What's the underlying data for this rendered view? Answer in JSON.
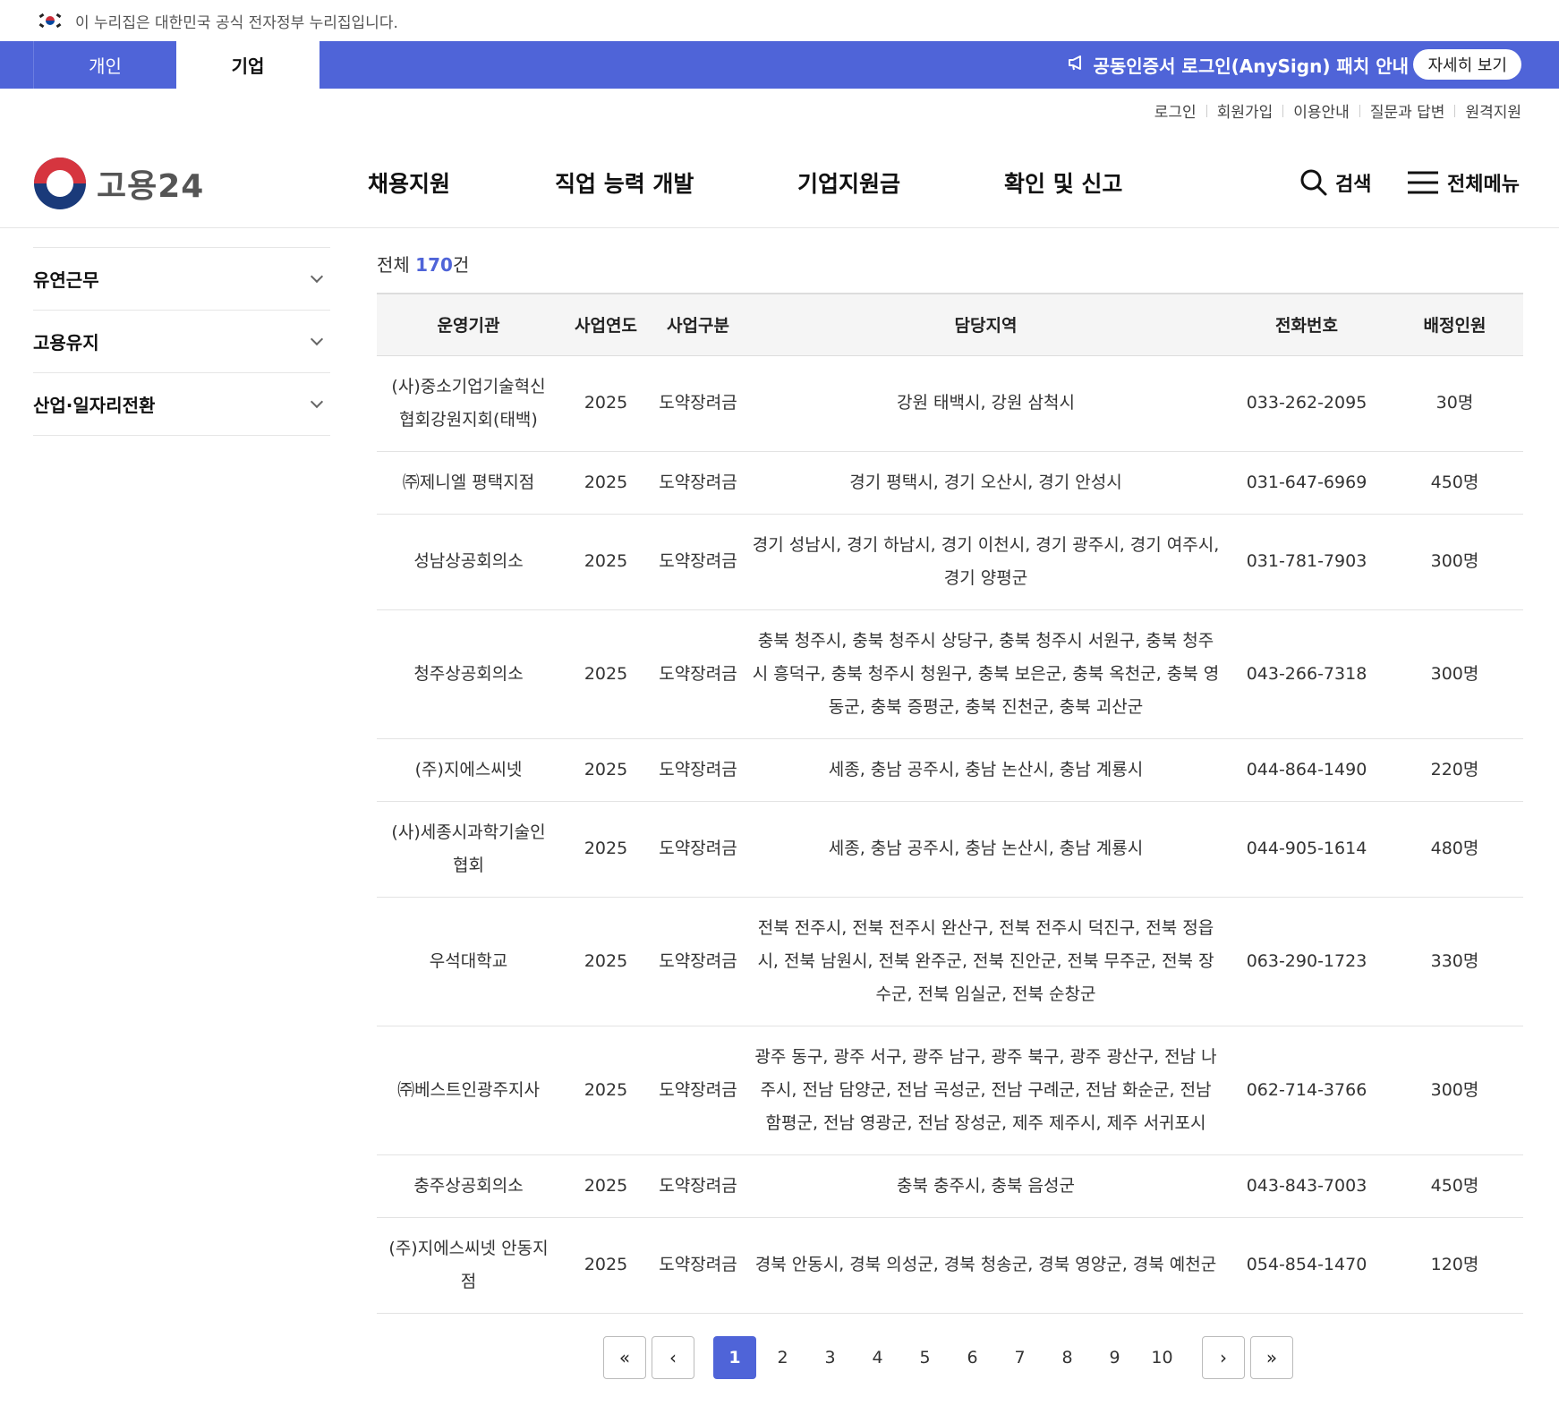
{
  "notice": {
    "text": "이 누리집은 대한민국 공식 전자정부 누리집입니다."
  },
  "topbar": {
    "tab_personal": "개인",
    "tab_company": "기업",
    "announcement": "공동인증서 로그인(AnySign) 패치 안내",
    "detail_button": "자세히 보기"
  },
  "util_links": [
    "로그인",
    "회원가입",
    "이용안내",
    "질문과 답변",
    "원격지원"
  ],
  "header": {
    "logo_text": "고용24",
    "nav": [
      "채용지원",
      "직업 능력 개발",
      "기업지원금",
      "확인 및 신고"
    ],
    "search_label": "검색",
    "menu_label": "전체메뉴"
  },
  "sidebar": {
    "items": [
      "유연근무",
      "고용유지",
      "산업·일자리전환"
    ]
  },
  "total": {
    "prefix": "전체 ",
    "count": "170",
    "suffix": "건"
  },
  "table": {
    "headers": [
      "운영기관",
      "사업연도",
      "사업구분",
      "담당지역",
      "전화번호",
      "배정인원"
    ],
    "rows": [
      [
        "(사)중소기업기술혁신 협회강원지회(태백)",
        "2025",
        "도약장려금",
        "강원 태백시, 강원 삼척시",
        "033-262-2095",
        "30명"
      ],
      [
        "㈜제니엘 평택지점",
        "2025",
        "도약장려금",
        "경기 평택시, 경기 오산시, 경기 안성시",
        "031-647-6969",
        "450명"
      ],
      [
        "성남상공회의소",
        "2025",
        "도약장려금",
        "경기 성남시, 경기 하남시, 경기 이천시, 경기 광주시, 경기 여주시, 경기 양평군",
        "031-781-7903",
        "300명"
      ],
      [
        "청주상공회의소",
        "2025",
        "도약장려금",
        "충북 청주시, 충북 청주시 상당구, 충북 청주시 서원구, 충북 청주시 흥덕구, 충북 청주시 청원구, 충북 보은군, 충북 옥천군, 충북 영동군, 충북 증평군, 충북 진천군, 충북 괴산군",
        "043-266-7318",
        "300명"
      ],
      [
        "(주)지에스씨넷",
        "2025",
        "도약장려금",
        "세종, 충남 공주시, 충남 논산시, 충남 계룡시",
        "044-864-1490",
        "220명"
      ],
      [
        "(사)세종시과학기술인 협회",
        "2025",
        "도약장려금",
        "세종, 충남 공주시, 충남 논산시, 충남 계룡시",
        "044-905-1614",
        "480명"
      ],
      [
        "우석대학교",
        "2025",
        "도약장려금",
        "전북 전주시, 전북 전주시 완산구, 전북 전주시 덕진구, 전북 정읍시, 전북 남원시, 전북 완주군, 전북 진안군, 전북 무주군, 전북 장수군, 전북 임실군, 전북 순창군",
        "063-290-1723",
        "330명"
      ],
      [
        "㈜베스트인광주지사",
        "2025",
        "도약장려금",
        "광주 동구, 광주 서구, 광주 남구, 광주 북구, 광주 광산구, 전남 나주시, 전남 담양군, 전남 곡성군, 전남 구례군, 전남 화순군, 전남 함평군, 전남 영광군, 전남 장성군, 제주 제주시, 제주 서귀포시",
        "062-714-3766",
        "300명"
      ],
      [
        "충주상공회의소",
        "2025",
        "도약장려금",
        "충북 충주시, 충북 음성군",
        "043-843-7003",
        "450명"
      ],
      [
        "(주)지에스씨넷 안동지점",
        "2025",
        "도약장려금",
        "경북 안동시, 경북 의성군, 경북 청송군, 경북 영양군, 경북 예천군",
        "054-854-1470",
        "120명"
      ]
    ]
  },
  "pagination": {
    "first": "«",
    "prev": "‹",
    "pages": [
      "1",
      "2",
      "3",
      "4",
      "5",
      "6",
      "7",
      "8",
      "9",
      "10"
    ],
    "current": "1",
    "next": "›",
    "last": "»"
  },
  "colors": {
    "primary": "#4f64d8",
    "text": "#222222",
    "border": "#e3e3e3"
  }
}
